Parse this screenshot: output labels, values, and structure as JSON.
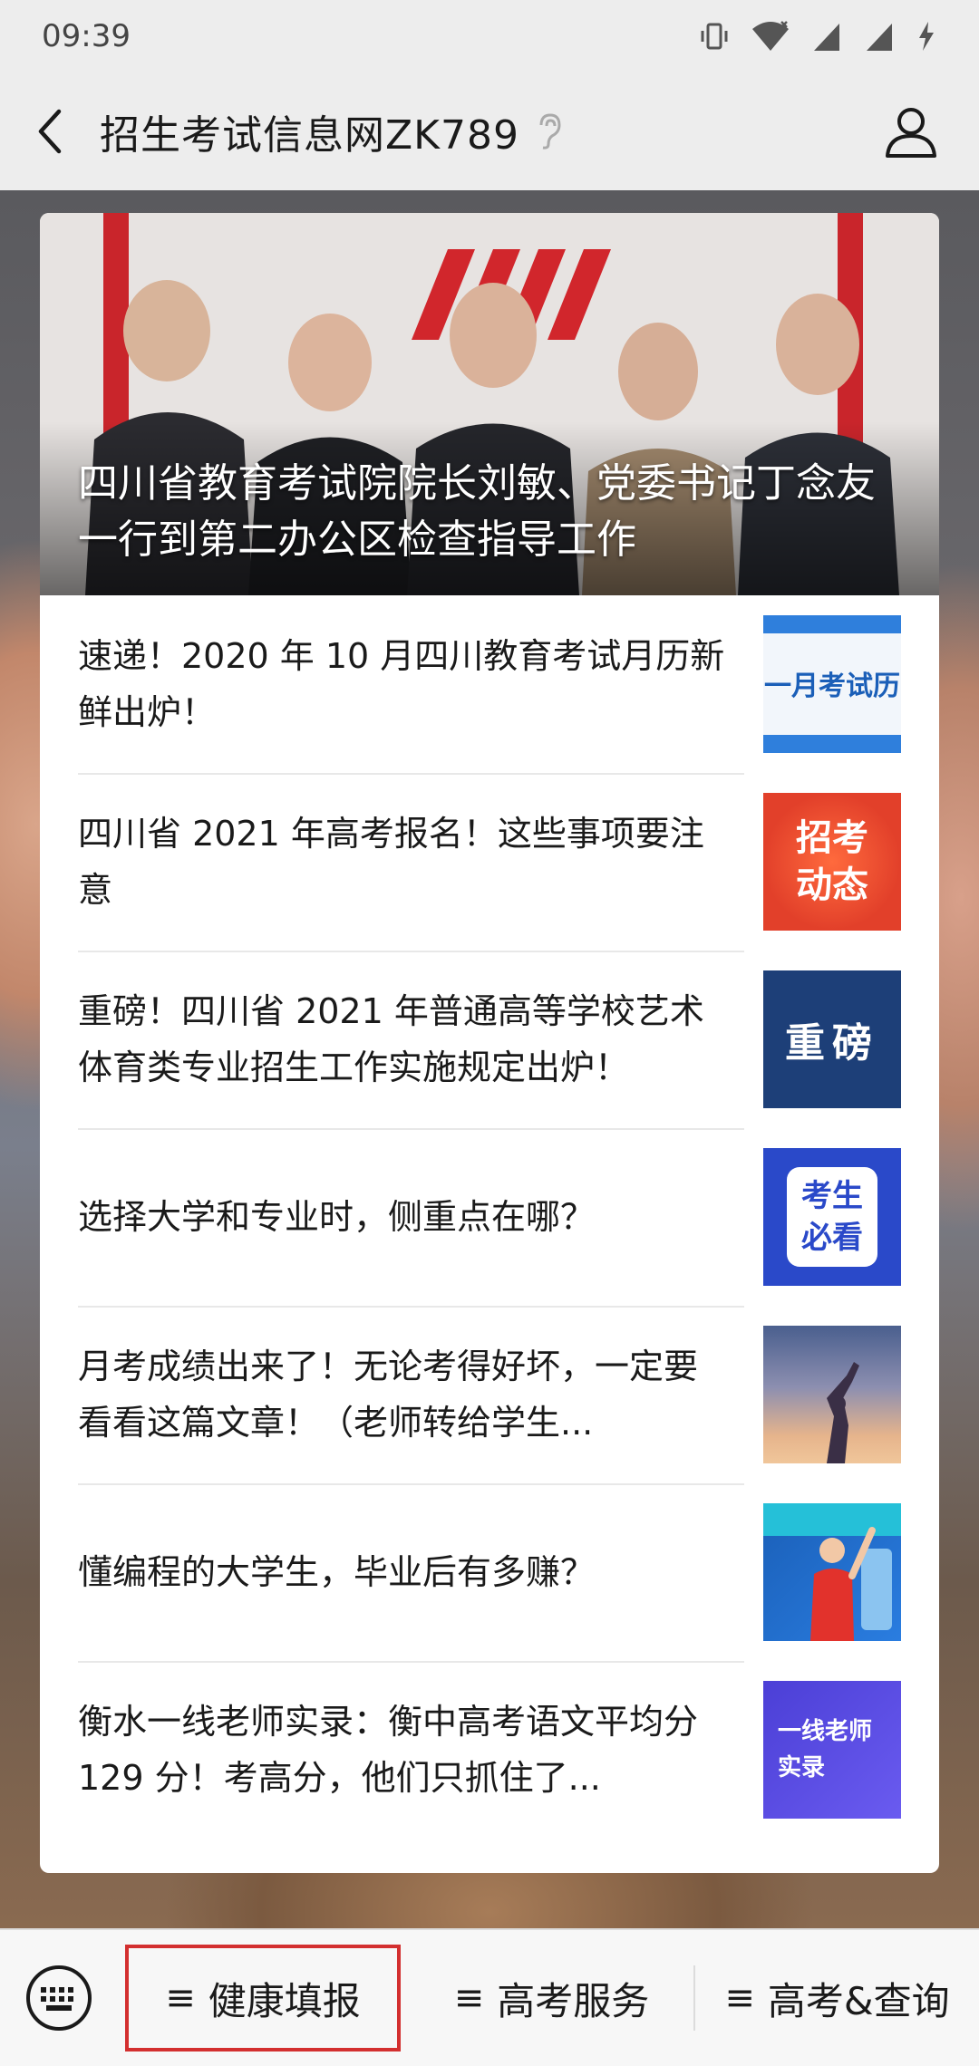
{
  "status_bar": {
    "time": "09:39"
  },
  "title_bar": {
    "title": "招生考试信息网ZK789"
  },
  "hero": {
    "caption": "四川省教育考试院院长刘敏、党委书记丁念友一行到第二办公区检查指导工作"
  },
  "articles": [
    {
      "title": "速递！2020 年 10 月四川教育考试月历新鲜出炉！",
      "thumb": "一月考试历"
    },
    {
      "title": "四川省 2021 年高考报名！这些事项要注意",
      "thumb": "招考动态"
    },
    {
      "title": "重磅！四川省 2021 年普通高等学校艺术体育类专业招生工作实施规定出炉！",
      "thumb": "重磅"
    },
    {
      "title": "选择大学和专业时，侧重点在哪？",
      "thumb": "考生必看"
    },
    {
      "title": "月考成绩出来了！无论考得好坏，一定要看看这篇文章！（老师转给学生...",
      "thumb": ""
    },
    {
      "title": "懂编程的大学生，毕业后有多赚？",
      "thumb": ""
    },
    {
      "title": "衡水一线老师实录：衡中高考语文平均分 129 分！考高分，他们只抓住了...",
      "thumb": "一线老师 实录"
    }
  ],
  "bottom_menu": {
    "items": [
      {
        "label": "健康填报"
      },
      {
        "label": "高考服务"
      },
      {
        "label": "高考&查询"
      }
    ]
  },
  "colors": {
    "highlight_border": "#d32f2f",
    "card_bg": "#ffffff",
    "chrome_bg": "#ededed"
  }
}
